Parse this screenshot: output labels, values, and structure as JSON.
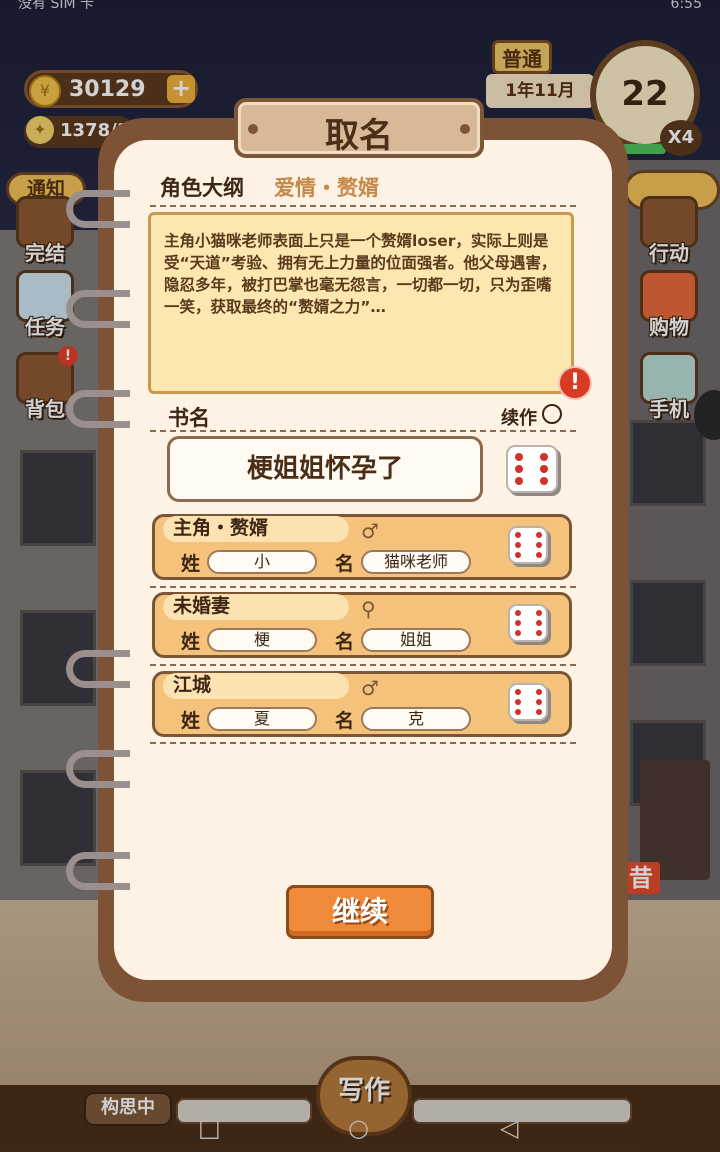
{
  "status_bar": {
    "left": "没有 SIM 卡",
    "right": "6:55"
  },
  "hud": {
    "coins": "30129",
    "coin_add": "+",
    "energy": "1378/1",
    "mode": "普通",
    "date": "1年11月",
    "day": "22",
    "speed": "X4"
  },
  "side_left": {
    "notice": "通知",
    "items": [
      {
        "label": "完结"
      },
      {
        "label": "任务"
      },
      {
        "label": "背包",
        "badge": "!"
      }
    ]
  },
  "side_right": {
    "items": [
      {
        "label": "行动"
      },
      {
        "label": "购物"
      },
      {
        "label": "手机"
      }
    ]
  },
  "bottom": {
    "think": "构思中",
    "write": "写作"
  },
  "scene": {
    "sign": "昔"
  },
  "dialog": {
    "title": "取名",
    "outline_label": "角色大纲",
    "genre": "爱情・赘婿",
    "outline_text": "主角小猫咪老师表面上只是一个赘婿loser，实际上则是受“天道”考验、拥有无上力量的位面强者。他父母遇害，隐忍多年，被打巴掌也毫无怨言，一切都一切，只为歪嘴一笑，获取最终的“赘婿之力”…",
    "warning": "!",
    "book_label": "书名",
    "continue_write": "续作",
    "book_name": "梗姐姐怀孕了",
    "characters": [
      {
        "role": "主角・赘婿",
        "gender": "♂",
        "surname_label": "姓",
        "surname": "小",
        "name_label": "名",
        "name": "猫咪老师"
      },
      {
        "role": "未婚妻",
        "gender": "⚲",
        "surname_label": "姓",
        "surname": "梗",
        "name_label": "名",
        "name": "姐姐"
      },
      {
        "role": "江城",
        "gender": "♂",
        "surname_label": "姓",
        "surname": "夏",
        "name_label": "名",
        "name": "克"
      }
    ],
    "continue_button": "继续"
  },
  "nav": {
    "back": "◁",
    "home": "○",
    "recent": "□"
  },
  "colors": {
    "accent": "#ef8a3a",
    "paper": "#fdf2e4",
    "frame": "#7e5234"
  }
}
